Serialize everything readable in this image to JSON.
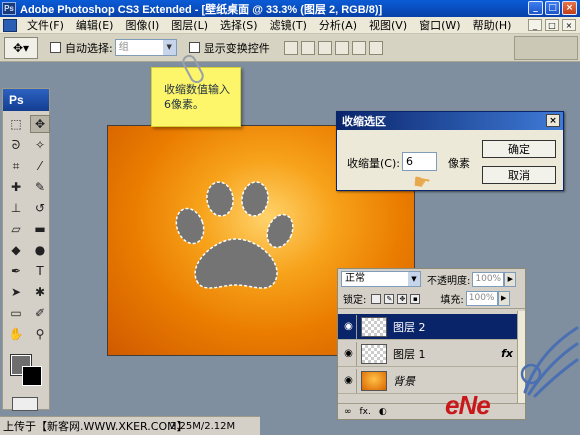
{
  "window": {
    "app_badge": "Ps",
    "title": "Adobe Photoshop CS3 Extended - [壁纸桌面 @ 33.3% (图层 2, RGB/8)]",
    "controls": [
      "_",
      "□",
      "×"
    ]
  },
  "menu": {
    "items": [
      "文件(F)",
      "编辑(E)",
      "图像(I)",
      "图层(L)",
      "选择(S)",
      "滤镜(T)",
      "分析(A)",
      "视图(V)",
      "窗口(W)",
      "帮助(H)"
    ],
    "right_controls": [
      "_",
      "□",
      "×"
    ]
  },
  "options": {
    "tool_preset_icon": "move-tool-icon",
    "auto_select_label": "自动选择:",
    "auto_select_value": "组",
    "show_transform_label": "显示变换控件"
  },
  "toolbox": {
    "logo": "Ps",
    "tools": [
      {
        "name": "marquee-tool",
        "glyph": "⬚"
      },
      {
        "name": "move-tool",
        "glyph": "✥"
      },
      {
        "name": "lasso-tool",
        "glyph": "ᘐ"
      },
      {
        "name": "magic-wand-tool",
        "glyph": "✧"
      },
      {
        "name": "crop-tool",
        "glyph": "⌗"
      },
      {
        "name": "eyedropper-tool",
        "glyph": "⁄"
      },
      {
        "name": "healing-brush-tool",
        "glyph": "✚"
      },
      {
        "name": "brush-tool",
        "glyph": "✎"
      },
      {
        "name": "clone-stamp-tool",
        "glyph": "⊥"
      },
      {
        "name": "history-brush-tool",
        "glyph": "↺"
      },
      {
        "name": "eraser-tool",
        "glyph": "▱"
      },
      {
        "name": "gradient-tool",
        "glyph": "▬"
      },
      {
        "name": "blur-tool",
        "glyph": "◆"
      },
      {
        "name": "dodge-tool",
        "glyph": "●"
      },
      {
        "name": "pen-tool",
        "glyph": "✒"
      },
      {
        "name": "type-tool",
        "glyph": "T"
      },
      {
        "name": "path-selection-tool",
        "glyph": "➤"
      },
      {
        "name": "shape-tool",
        "glyph": "✱"
      },
      {
        "name": "notes-tool",
        "glyph": "▭"
      },
      {
        "name": "eyedropper-tool-2",
        "glyph": "✐"
      },
      {
        "name": "hand-tool",
        "glyph": "✋"
      },
      {
        "name": "zoom-tool",
        "glyph": "⚲"
      }
    ],
    "foreground_color": "#6e6e6e",
    "background_color": "#000000"
  },
  "note": {
    "text": "收缩数值输入6像素。"
  },
  "dialog": {
    "title": "收缩选区",
    "label": "收缩量(C):",
    "value": "6",
    "unit": "像素",
    "ok_label": "确定",
    "cancel_label": "取消",
    "close_glyph": "×"
  },
  "layers": {
    "blend_mode": "正常",
    "opacity_label": "不透明度:",
    "opacity_value": "100%",
    "lock_label": "锁定:",
    "fill_label": "填充:",
    "fill_value": "100%",
    "rows": [
      {
        "name": "图层 2",
        "selected": true,
        "fx": ""
      },
      {
        "name": "图层 1",
        "selected": false,
        "fx": "fx"
      },
      {
        "name": "背景",
        "selected": false,
        "fx": ""
      }
    ],
    "footer_icons": [
      "∞",
      "fx.",
      "◐"
    ]
  },
  "status": {
    "left_text": "上传于【新客网.WWW.XKER.COM】",
    "doc_size": "2.25M/2.12M"
  },
  "watermark": {
    "brand": "eNe"
  },
  "colors": {
    "title_blue": "#0a5bd6",
    "canvas_orange": "#ea7c00",
    "selected_layer": "#0a246a",
    "note_yellow": "#fdf56a"
  }
}
